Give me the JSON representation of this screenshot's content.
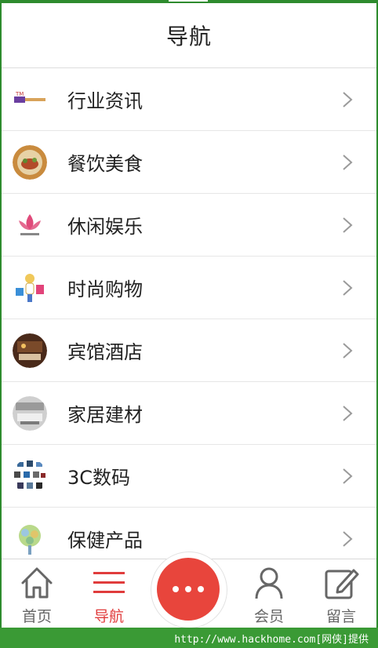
{
  "header": {
    "title": "导航"
  },
  "nav_items": [
    {
      "label": "行业资讯",
      "icon": "news-logo-icon"
    },
    {
      "label": "餐饮美食",
      "icon": "food-photo-icon"
    },
    {
      "label": "休闲娱乐",
      "icon": "lotus-logo-icon"
    },
    {
      "label": "时尚购物",
      "icon": "shopping-girl-icon"
    },
    {
      "label": "宾馆酒店",
      "icon": "hotel-room-icon"
    },
    {
      "label": "家居建材",
      "icon": "interior-photo-icon"
    },
    {
      "label": "3C数码",
      "icon": "digital-devices-icon"
    },
    {
      "label": "保健产品",
      "icon": "health-tree-icon"
    }
  ],
  "tabbar": {
    "home": "首页",
    "nav": "导航",
    "member": "会员",
    "message": "留言"
  },
  "colors": {
    "accent": "#e8453c",
    "frame": "#2e8b2e"
  },
  "watermark": {
    "text": "http://www.hackhome.com[网侠]提供"
  }
}
